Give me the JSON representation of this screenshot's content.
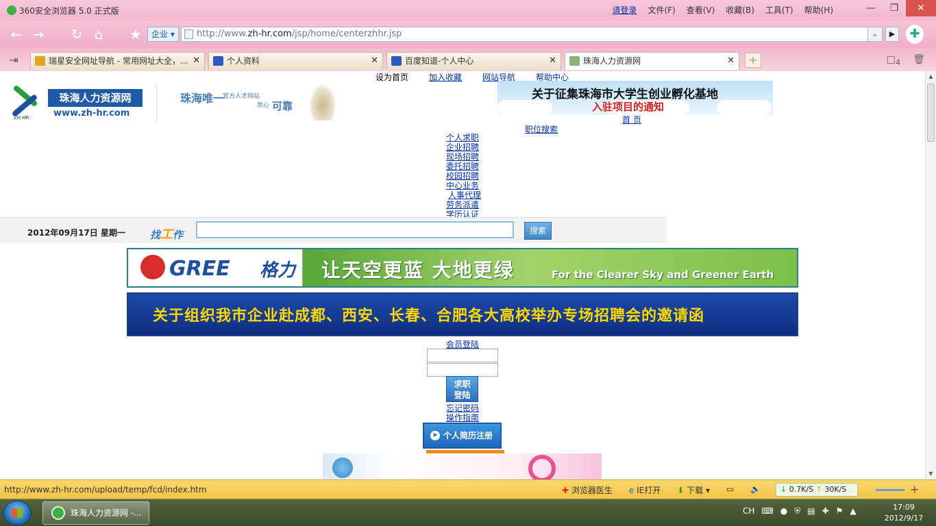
{
  "browser": {
    "app_title": "360安全浏览器 5.0 正式版",
    "login_link": "请登录",
    "menu": [
      "文件(F)",
      "查看(V)",
      "收藏(B)",
      "工具(T)",
      "帮助(H)"
    ],
    "mode": "企业",
    "url_prefix": "http://www.",
    "url_host": "zh-hr.com",
    "url_path": "/jsp/home/centerzhhr.jsp",
    "tabs": [
      {
        "label": "瑞星安全网址导航 - 常用网址大全，...",
        "icon_color": "#e7a21f"
      },
      {
        "label": "个人资料",
        "icon_color": "#2a59c7"
      },
      {
        "label": "百度知道-个人中心",
        "icon_color": "#2a59c7"
      },
      {
        "label": "珠海人力资源网",
        "icon_color": "#8cb27a"
      }
    ],
    "tab_count": "4"
  },
  "page": {
    "top_links": [
      "设为首页",
      "加入收藏",
      "网站导航",
      "帮助中心"
    ],
    "site_name": "珠海人力资源网",
    "site_url": "www.zh-hr.com",
    "logo_tag": "ZH·HR",
    "slogan_main": "珠海唯一",
    "slogan_small1": "官方人才网站",
    "slogan_small2": "放心",
    "slogan_big2": "可靠",
    "notice_line1": "关于征集珠海市大学生创业孵化基地",
    "notice_line2": "入驻项目的通知",
    "home_link": "首  页",
    "job_search_link": "职位搜索",
    "nav_items": [
      "个人求职",
      "企业招聘",
      "现场招聘",
      "委托招聘",
      "校园招聘",
      "中心业务",
      "人事代理",
      "劳务派遣",
      "学历认证"
    ],
    "date": "2012年09月17日  星期一",
    "find_label_a": "找",
    "find_label_b": "工",
    "find_label_c": "作",
    "search_value": "",
    "search_button": "搜索",
    "gree_brand": "GREE",
    "gree_cn_brand": "格力",
    "gree_slogan_cn": "让天空更蓝  大地更绿",
    "gree_slogan_en": "For the Clearer Sky and Greener Earth",
    "invite_text": "关于组织我市企业赴成都、西安、长春、合肥各大高校举办专场招聘会的邀请函",
    "member_login": "会员登陆",
    "login_button_l1": "求职",
    "login_button_l2": "登陆",
    "forgot_password": "忘记密码",
    "guide": "操作指南",
    "register_button": "个人简历注册"
  },
  "statusbar": {
    "hover_url": "http://www.zh-hr.com/upload/temp/fcd/index.htm",
    "tools": [
      "浏览器医生",
      "IE打开",
      "下载"
    ],
    "down_speed": "0.7K/S",
    "up_speed": "30K/S"
  },
  "taskbar": {
    "task_label": "珠海人力资源网 -...",
    "lang": "CH",
    "time": "17:09",
    "date": "2012/9/17"
  }
}
